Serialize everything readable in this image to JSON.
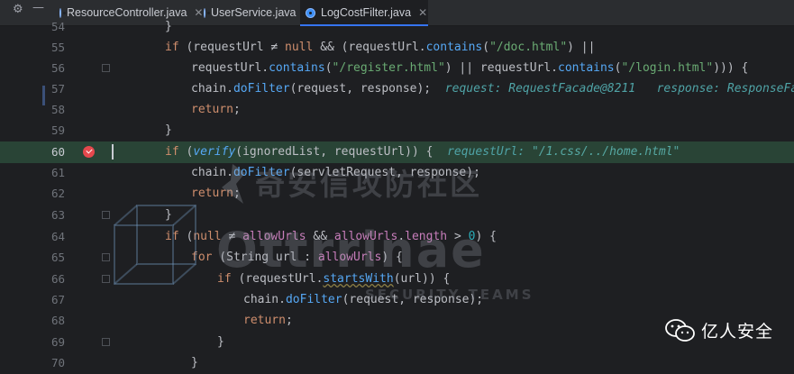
{
  "tabs": [
    {
      "label": "ResourceController.java",
      "active": false
    },
    {
      "label": "UserService.java",
      "active": false
    },
    {
      "label": "LogCostFilter.java",
      "active": true
    }
  ],
  "toolbar": {
    "settings_icon": "gear-icon",
    "minimize_icon": "minus-icon"
  },
  "gutter": {
    "line_numbers": [
      "54",
      "55",
      "56",
      "57",
      "58",
      "59",
      "60",
      "61",
      "62",
      "63",
      "64",
      "65",
      "66",
      "67",
      "68",
      "69",
      "70"
    ],
    "breakpoint_line": "60"
  },
  "code": {
    "l54": "}",
    "l55": {
      "kw_if": "if",
      "p1": " (requestUrl ",
      "op": "≠",
      "kw_null": " null",
      "p2": " && (requestUrl.",
      "fn": "contains",
      "str": "\"/doc.html\"",
      "p3": ") ||"
    },
    "l56": {
      "p1": "requestUrl.",
      "fn1": "contains",
      "str1": "\"/register.html\"",
      "mid": ") || requestUrl.",
      "fn2": "contains",
      "str2": "\"/login.html\"",
      "end": "))) {"
    },
    "l57": {
      "p1": "chain.",
      "fn": "doFilter",
      "args": "(request, response);",
      "hint1": "request: RequestFacade@8211",
      "hint2": "response: ResponseFacade"
    },
    "l58": {
      "kw": "return",
      "end": ";"
    },
    "l59": "}",
    "l60": {
      "kw_if": "if",
      "fn": "verify",
      "args": "(ignoredList, requestUrl)) {",
      "hint_name": "requestUrl:",
      "hint_val": "\"/1.css/../home.html\""
    },
    "l61": {
      "p1": "chain.",
      "fn": "doFilter",
      "args": "(servletRequest, response);"
    },
    "l62": {
      "kw": "return",
      "end": ";"
    },
    "l63": "}",
    "l64": {
      "kw_if": "if",
      "kw_null": "null",
      "op": " ≠ ",
      "field1": "allowUrls",
      "and": " && ",
      "field2": "allowUrls",
      "dot": ".",
      "len": "length",
      "gt": " > ",
      "num": "0",
      "end": ") {"
    },
    "l65": {
      "kw_for": "for",
      "p1": " (String url : ",
      "field": "allowUrls",
      "end": ") {"
    },
    "l66": {
      "kw_if": "if",
      "p1": " (requestUrl.",
      "fn": "startsWith",
      "args": "(url)) {"
    },
    "l67": {
      "p1": "chain.",
      "fn": "doFilter",
      "args": "(request, response);"
    },
    "l68": {
      "kw": "return",
      "end": ";"
    },
    "l69": "}",
    "l70": "}"
  },
  "watermark": {
    "line1": "奇安信攻防社区",
    "line2": "Ottrrinae",
    "line3": "SECURITY TEAMS"
  },
  "badge": {
    "icon": "wechat-icon",
    "label": "亿人安全"
  },
  "colors": {
    "keyword": "#cf8e6d",
    "string": "#6aab73",
    "method": "#56a8f5",
    "field": "#c77dba",
    "number": "#2aacb8",
    "highlight_line": "#294436",
    "breakpoint": "#e5484d"
  }
}
